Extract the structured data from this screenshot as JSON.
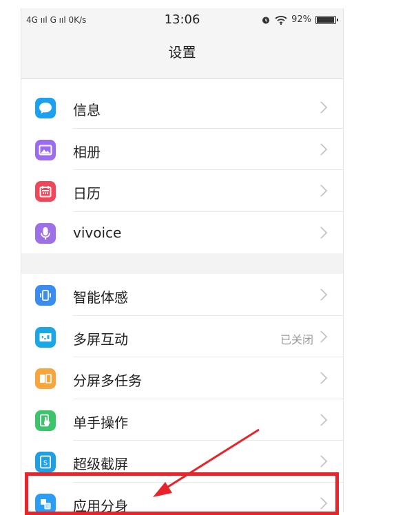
{
  "status_bar": {
    "left": "4G ııl  G ııl  0K/s",
    "time": "13:06",
    "battery": "92%"
  },
  "header": {
    "title": "设置"
  },
  "groups": [
    {
      "items": [
        {
          "label": "信息",
          "icon": "message-icon",
          "color": "#1aa1f0"
        },
        {
          "label": "相册",
          "icon": "photo-icon",
          "color": "#9b6cf0"
        },
        {
          "label": "日历",
          "icon": "calendar-icon",
          "color": "#f0485a"
        },
        {
          "label": "vivoice",
          "icon": "microphone-icon",
          "color": "#9d70e8"
        }
      ]
    },
    {
      "items": [
        {
          "label": "智能体感",
          "icon": "motion-sense-icon",
          "color": "#3a8cf0"
        },
        {
          "label": "多屏互动",
          "value": "已关闭",
          "icon": "multi-screen-icon",
          "color": "#1ba7e6"
        },
        {
          "label": "分屏多任务",
          "icon": "split-screen-icon",
          "color": "#f7a53c"
        },
        {
          "label": "单手操作",
          "icon": "one-hand-icon",
          "color": "#3cc46a"
        },
        {
          "label": "超级截屏",
          "icon": "screenshot-icon",
          "color": "#1fa0e0"
        },
        {
          "label": "应用分身",
          "icon": "app-clone-icon",
          "color": "#2a9df4"
        }
      ]
    }
  ]
}
